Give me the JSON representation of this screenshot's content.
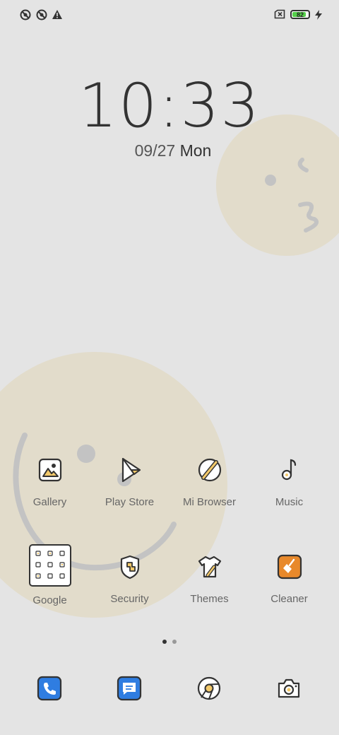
{
  "status_bar": {
    "battery_level": "82",
    "icons": [
      "location-off-icon",
      "location-off-icon",
      "warning-icon",
      "no-sim-icon",
      "battery-icon",
      "charging-icon"
    ]
  },
  "lockscreen": {
    "time": "10:33",
    "date": "09/27",
    "weekday": "Mon"
  },
  "apps": [
    {
      "label": "Gallery",
      "icon": "gallery-icon"
    },
    {
      "label": "Play Store",
      "icon": "play-store-icon"
    },
    {
      "label": "Mi Browser",
      "icon": "browser-icon"
    },
    {
      "label": "Music",
      "icon": "music-icon"
    },
    {
      "label": "Google",
      "icon": "google-folder-icon"
    },
    {
      "label": "Security",
      "icon": "security-icon"
    },
    {
      "label": "Themes",
      "icon": "themes-icon"
    },
    {
      "label": "Cleaner",
      "icon": "cleaner-icon"
    }
  ],
  "page_indicator": {
    "pages": 2,
    "current": 1
  },
  "dock": [
    {
      "icon": "phone-icon"
    },
    {
      "icon": "messages-icon"
    },
    {
      "icon": "chrome-icon"
    },
    {
      "icon": "camera-icon"
    }
  ],
  "colors": {
    "background": "#e4e4e4",
    "wallpaper_circle": "#e2dccb",
    "accent_blue": "#2f7de1",
    "accent_orange": "#e8892b",
    "accent_yellow": "#f3c96a"
  }
}
